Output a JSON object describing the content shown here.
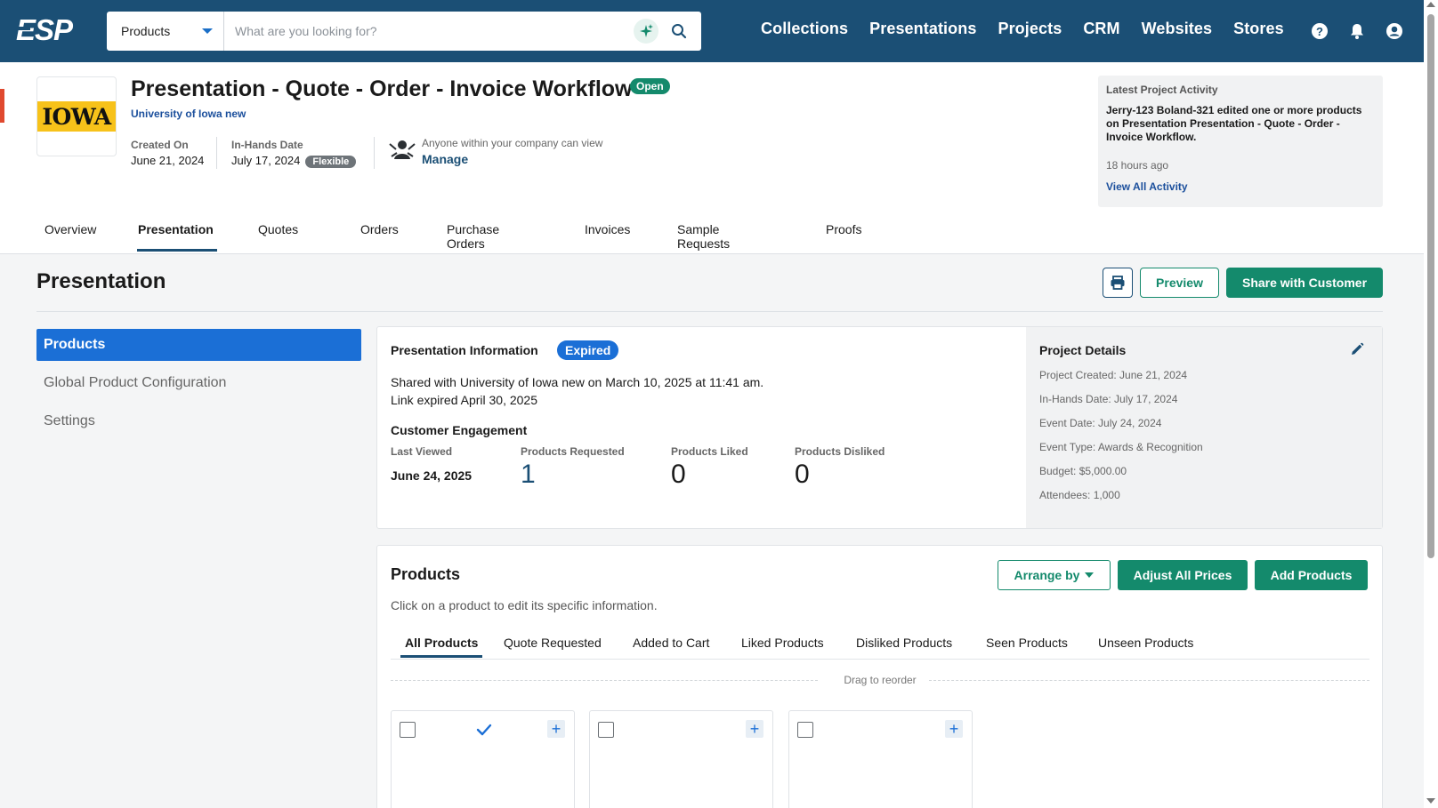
{
  "brand": {
    "logo": "ESP",
    "primary": "#1b4f75",
    "accent": "#148a6c",
    "blue": "#1b6fd6"
  },
  "search": {
    "type": "Products",
    "placeholder": "What are you looking for?"
  },
  "nav": {
    "links": [
      "Collections",
      "Presentations",
      "Projects",
      "CRM",
      "Websites",
      "Stores"
    ],
    "icons": [
      "help-icon",
      "bell-icon",
      "user-icon"
    ]
  },
  "project": {
    "logo_text": "IOWA",
    "title": "Presentation - Quote - Order - Invoice Workflow",
    "status": "Open",
    "customer": "University of Iowa new",
    "created_label": "Created On",
    "created_value": "June 21, 2024",
    "inhands_label": "In-Hands Date",
    "inhands_value": "July 17, 2024",
    "inhands_badge": "Flexible",
    "permission_text": "Anyone within your company can view",
    "permission_link": "Manage"
  },
  "activity": {
    "title": "Latest Project Activity",
    "text": "Jerry-123 Boland-321 edited one or more products on Presentation Presentation - Quote - Order - Invoice Workflow.",
    "time": "18 hours ago",
    "link": "View All Activity"
  },
  "tabs": [
    "Overview",
    "Presentation",
    "Quotes",
    "Orders",
    "Purchase Orders",
    "Invoices",
    "Sample Requests",
    "Proofs"
  ],
  "section": {
    "title": "Presentation",
    "preview": "Preview",
    "share": "Share with Customer"
  },
  "side_menu": [
    "Products",
    "Global Product Configuration",
    "Settings"
  ],
  "presentation_info": {
    "title": "Presentation Information",
    "status": "Expired",
    "shared_line": "Shared with University of Iowa new on March 10, 2025 at 11:41 am.",
    "expired_line": "Link expired April 30, 2025",
    "engagement_title": "Customer Engagement",
    "stats": [
      {
        "label": "Last Viewed",
        "value": "June 24, 2025"
      },
      {
        "label": "Products Requested",
        "value": "1"
      },
      {
        "label": "Products Liked",
        "value": "0"
      },
      {
        "label": "Products Disliked",
        "value": "0"
      }
    ]
  },
  "project_details": {
    "title": "Project Details",
    "lines": [
      "Project Created: June 21, 2024",
      "In-Hands Date: July 17, 2024",
      "Event Date: July 24, 2024",
      "Event Type: Awards & Recognition",
      "Budget: $5,000.00",
      "Attendees: 1,000"
    ]
  },
  "products": {
    "title": "Products",
    "subtitle": "Click on a product to edit its specific information.",
    "arrange": "Arrange by",
    "adjust": "Adjust All Prices",
    "add": "Add Products",
    "tabs": [
      "All Products",
      "Quote Requested",
      "Added to Cart",
      "Liked Products",
      "Disliked Products",
      "Seen Products",
      "Unseen Products"
    ],
    "drag_text": "Drag to reorder"
  }
}
